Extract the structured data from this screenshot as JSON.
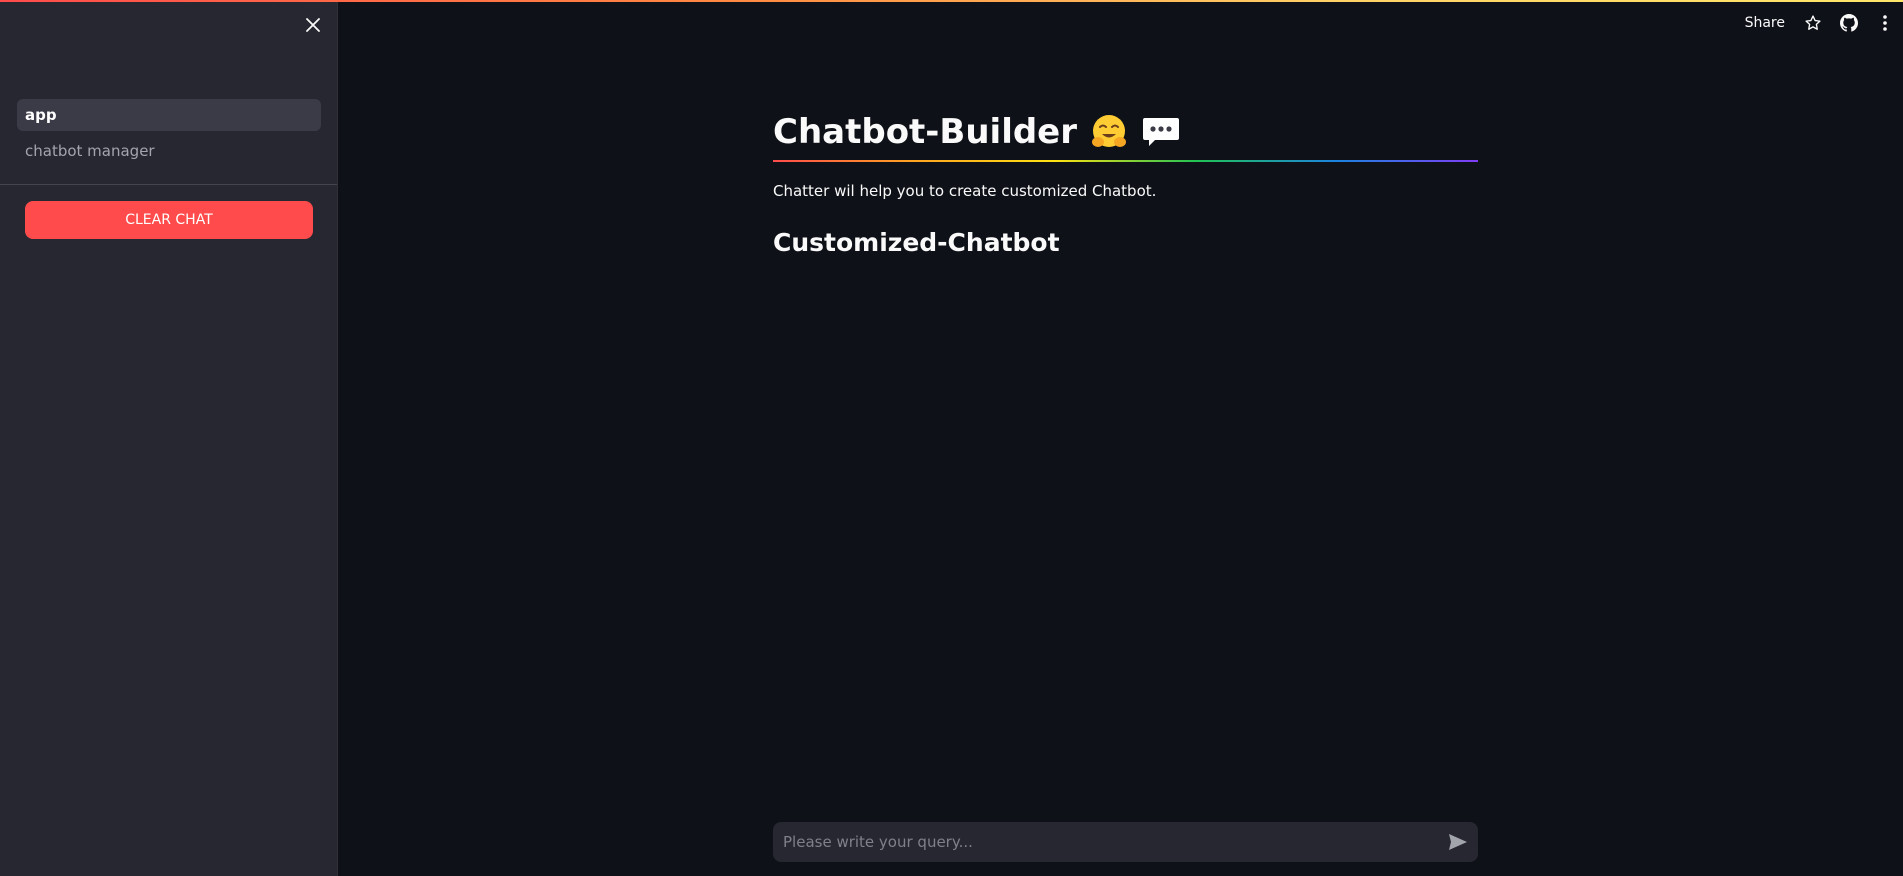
{
  "toolbar": {
    "share_label": "Share",
    "icons": [
      "star-icon",
      "github-icon",
      "more-vert-icon"
    ]
  },
  "sidebar": {
    "close_icon": "close-icon",
    "items": [
      {
        "label": "app",
        "active": true
      },
      {
        "label": "chatbot manager",
        "active": false
      }
    ],
    "clear_button_label": "CLEAR CHAT"
  },
  "main": {
    "title": "Chatbot-Builder",
    "title_emojis": [
      "hugging-face-emoji",
      "speech-bubble-emoji"
    ],
    "subtitle": "Chatter wil help you to create customized Chatbot.",
    "section_title": "Customized-Chatbot"
  },
  "chat_input": {
    "placeholder": "Please write your query...",
    "value": "",
    "send_icon": "send-icon"
  },
  "colors": {
    "background": "#0e1117",
    "sidebar": "#262730",
    "accent": "#ff4b4b",
    "text": "#fafafa"
  }
}
